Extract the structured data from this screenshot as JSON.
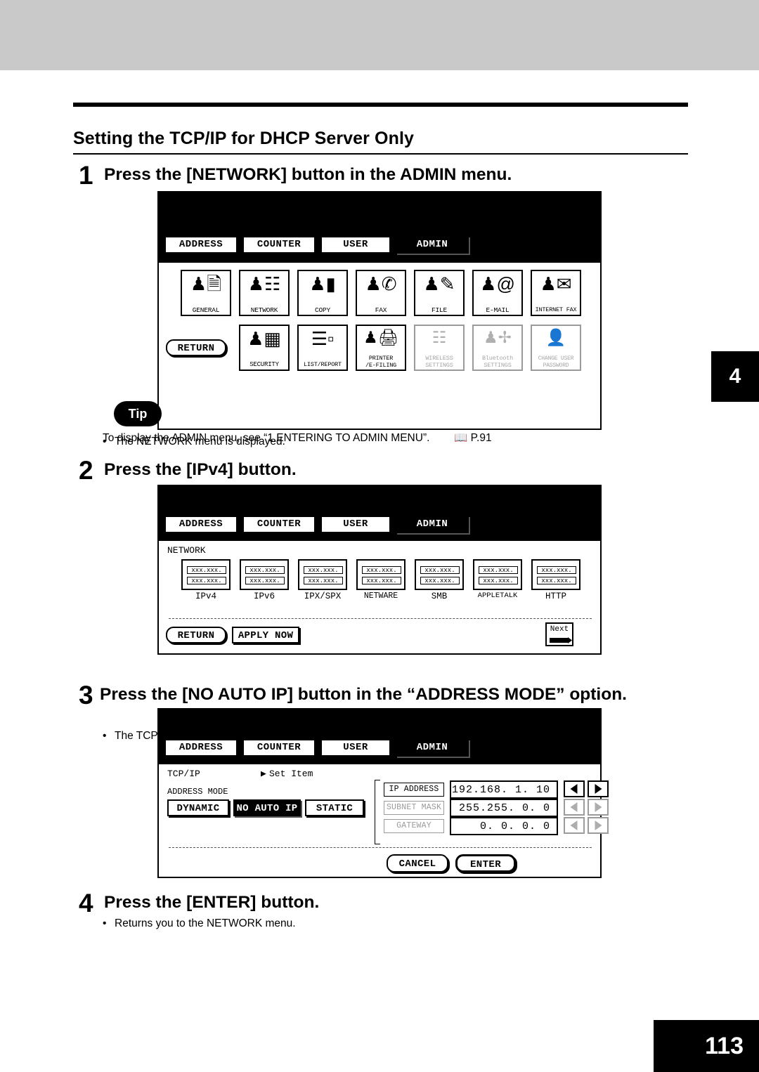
{
  "page": {
    "heading": "Setting the TCP/IP for DHCP Server Only",
    "number": "113",
    "tab_mark": "4"
  },
  "steps": [
    {
      "num": "1",
      "text": "Press the [NETWORK] button in the ADMIN menu.",
      "note": "The NETWORK menu is displayed."
    },
    {
      "num": "2",
      "text": "Press the [IPv4] button.",
      "note": "The TCP/IP screen is displayed."
    },
    {
      "num": "3",
      "text": "Press the [NO AUTO IP] button in the “ADDRESS MODE” option.",
      "note": ""
    },
    {
      "num": "4",
      "text": "Press the [ENTER] button.",
      "note": "Returns you to the NETWORK menu."
    }
  ],
  "tip": {
    "label": "Tip",
    "text": "To display the ADMIN menu, see “1.ENTERING TO ADMIN MENU”.        P.91",
    "text_before": "To display the ADMIN menu, see “1.ENTERING TO ADMIN MENU”.",
    "ref": "P.91"
  },
  "panel_tabs": [
    "ADDRESS",
    "COUNTER",
    "USER",
    "ADMIN"
  ],
  "panel1": {
    "row1": [
      {
        "label": "GENERAL",
        "icon": "person-document-icon",
        "enabled": true
      },
      {
        "label": "NETWORK",
        "icon": "person-network-icon",
        "enabled": true
      },
      {
        "label": "COPY",
        "icon": "person-copy-icon",
        "enabled": true
      },
      {
        "label": "FAX",
        "icon": "person-fax-icon",
        "enabled": true
      },
      {
        "label": "FILE",
        "icon": "person-file-icon",
        "enabled": true
      },
      {
        "label": "E-MAIL",
        "icon": "person-email-icon",
        "enabled": true
      },
      {
        "label": "INTERNET FAX",
        "icon": "person-internet-fax-icon",
        "enabled": true
      }
    ],
    "row2": [
      {
        "label": "SECURITY",
        "icon": "person-pdf-icon",
        "enabled": true
      },
      {
        "label": "LIST/REPORT",
        "icon": "list-report-icon",
        "enabled": true
      },
      {
        "label": "PRINTER\n/E-FILING",
        "label_line1": "PRINTER",
        "label_line2": "/E-FILING",
        "icon": "person-printer-icon",
        "enabled": true
      },
      {
        "label": "WIRELESS\nSETTINGS",
        "label_line1": "WIRELESS",
        "label_line2": "SETTINGS",
        "icon": "wireless-icon",
        "enabled": false
      },
      {
        "label": "Bluetooth\nSETTINGS",
        "label_line1": "Bluetooth",
        "label_line2": "SETTINGS",
        "icon": "bluetooth-icon",
        "enabled": false
      },
      {
        "label": "CHANGE USER\nPASSWORD",
        "label_line1": "CHANGE USER",
        "label_line2": "PASSWORD",
        "icon": "change-user-password-icon",
        "enabled": false
      }
    ],
    "return_label": "RETURN"
  },
  "panel2": {
    "title": "NETWORK",
    "buttons": [
      {
        "label": "IPv4",
        "line1": "xxx.xxx.",
        "line2": "xxx.xxx."
      },
      {
        "label": "IPv6",
        "line1": "xxx.xxx.",
        "line2": "xxx.xxx."
      },
      {
        "label": "IPX/SPX",
        "line1": "xxx.xxx.",
        "line2": "xxx.xxx."
      },
      {
        "label": "NETWARE",
        "line1": "xxx.xxx.",
        "line2": "xxx.xxx."
      },
      {
        "label": "SMB",
        "line1": "xxx.xxx.",
        "line2": "xxx.xxx."
      },
      {
        "label": "APPLETALK",
        "line1": "xxx.xxx.",
        "line2": "xxx.xxx."
      },
      {
        "label": "HTTP",
        "line1": "xxx.xxx.",
        "line2": "xxx.xxx."
      }
    ],
    "return_label": "RETURN",
    "apply_label": "APPLY NOW",
    "next_label": "Next"
  },
  "panel3": {
    "title": "TCP/IP",
    "set_item": "Set Item",
    "address_mode_label": "ADDRESS MODE",
    "modes": [
      {
        "label": "DYNAMIC",
        "selected": false
      },
      {
        "label": "NO AUTO IP",
        "selected": true
      },
      {
        "label": "STATIC",
        "selected": false
      }
    ],
    "fields": [
      {
        "label": "IP ADDRESS",
        "value": "192.168.  1.  10",
        "enabled": true
      },
      {
        "label": "SUBNET MASK",
        "value": "255.255.  0.   0",
        "enabled": false
      },
      {
        "label": "GATEWAY",
        "value": "0.  0.  0.   0",
        "enabled": false
      }
    ],
    "cancel_label": "CANCEL",
    "enter_label": "ENTER"
  }
}
